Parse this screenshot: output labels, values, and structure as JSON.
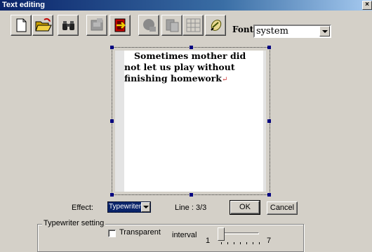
{
  "window": {
    "title": "Text editing",
    "close_glyph": "×"
  },
  "toolbar": {
    "buttons": [
      {
        "icon": "new-document-icon",
        "enabled": true
      },
      {
        "icon": "open-folder-icon",
        "enabled": true
      },
      {
        "icon": "binoculars-icon",
        "enabled": true
      },
      {
        "icon": "import-icon",
        "enabled": false
      },
      {
        "icon": "exit-icon",
        "enabled": true
      },
      {
        "icon": "shape-icon",
        "enabled": false
      },
      {
        "icon": "cards-icon",
        "enabled": false
      },
      {
        "icon": "table-grid-icon",
        "enabled": false
      },
      {
        "icon": "brush-icon",
        "enabled": true
      }
    ],
    "font_label": "Font",
    "font_value": "system"
  },
  "editor": {
    "text": "Sometimes mother did not let us play without finishing homework",
    "return_mark": "↵"
  },
  "controls": {
    "effect_label": "Effect:",
    "effect_value": "Typewriter",
    "line_status": "Line : 3/3",
    "ok_label": "OK",
    "cancel_label": "Cancel"
  },
  "typewriter_setting": {
    "title": "Typewriter setting",
    "transparent_label": "Transparent",
    "transparent_checked": false,
    "interval_label": "interval",
    "slider_min": "1",
    "slider_max": "7",
    "slider_value": 1
  }
}
